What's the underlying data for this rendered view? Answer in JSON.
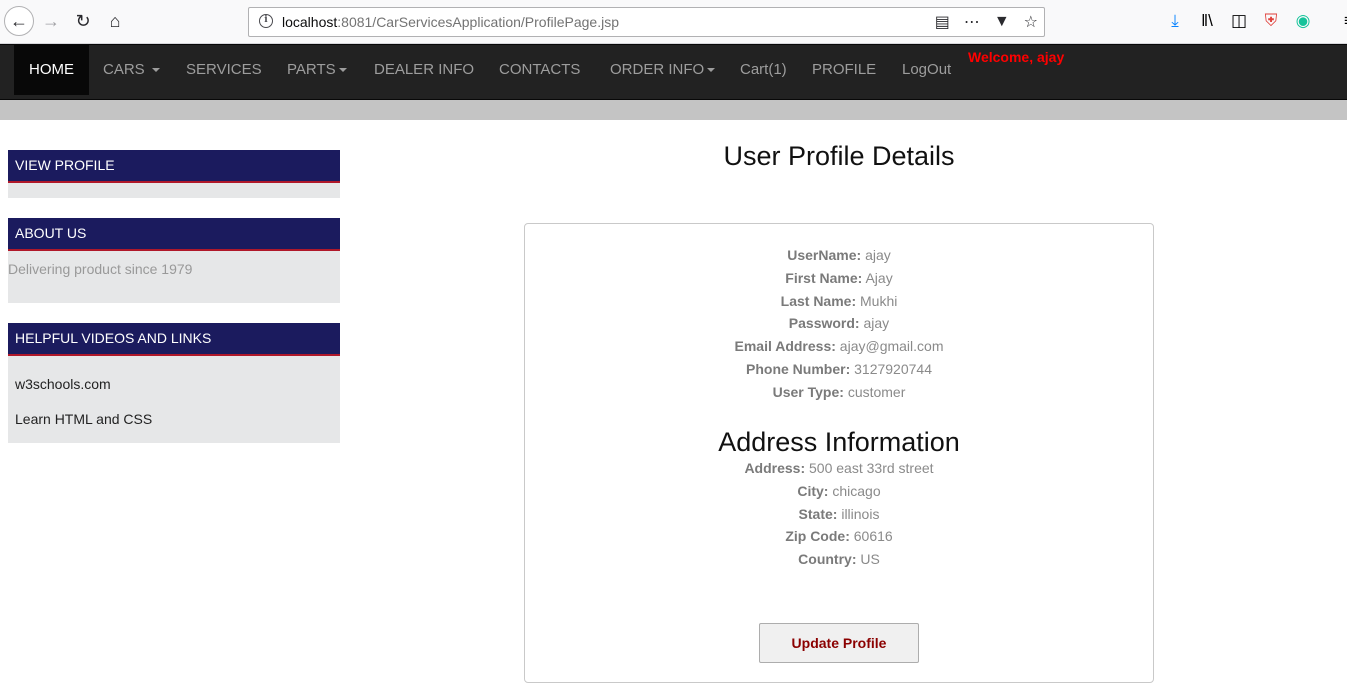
{
  "browser": {
    "url_host": "localhost",
    "url_rest": ":8081/CarServicesApplication/ProfilePage.jsp",
    "icons": [
      "back-icon",
      "forward-icon",
      "reload-icon",
      "home-icon",
      "info-icon",
      "reader-view-icon",
      "more-icon",
      "pocket-icon",
      "star-icon",
      "download-icon",
      "library-icon",
      "sidebar-icon",
      "shield-extension-icon",
      "grammarly-icon",
      "menu-icon"
    ]
  },
  "navbar": {
    "items": [
      {
        "label": "HOME"
      },
      {
        "label": "CARS"
      },
      {
        "label": "SERVICES"
      },
      {
        "label": "PARTS"
      },
      {
        "label": "DEALER INFO"
      },
      {
        "label": "CONTACTS"
      },
      {
        "label": "ORDER INFO"
      },
      {
        "label": "Cart(1)"
      },
      {
        "label": "PROFILE"
      },
      {
        "label": "LogOut"
      }
    ],
    "welcome": "Welcome, ajay"
  },
  "sidebar": {
    "view_profile": "VIEW PROFILE",
    "about_us": "ABOUT US",
    "about_text": "Delivering product since 1979",
    "helpful": "HELPFUL VIDEOS AND LINKS",
    "links": [
      "w3schools.com",
      "Learn HTML and CSS"
    ]
  },
  "main": {
    "title": "User Profile Details",
    "profile": [
      {
        "label": "UserName:",
        "value": "ajay"
      },
      {
        "label": "First Name:",
        "value": "Ajay"
      },
      {
        "label": "Last Name:",
        "value": "Mukhi"
      },
      {
        "label": "Password:",
        "value": "ajay"
      },
      {
        "label": "Email Address:",
        "value": "ajay@gmail.com"
      },
      {
        "label": "Phone Number:",
        "value": "3127920744"
      },
      {
        "label": "User Type:",
        "value": "customer"
      }
    ],
    "address_title": "Address Information",
    "address": [
      {
        "label": "Address:",
        "value": "500 east 33rd street"
      },
      {
        "label": "City:",
        "value": "chicago"
      },
      {
        "label": "State:",
        "value": "illinois"
      },
      {
        "label": "Zip Code:",
        "value": "60616"
      },
      {
        "label": "Country:",
        "value": "US"
      }
    ],
    "update_button": "Update Profile"
  },
  "colors": {
    "navbar_bg": "#222222",
    "panel_head_bg": "#1b1b5e",
    "panel_accent": "#b0182a",
    "welcome": "#ff0000",
    "button_text": "#8b0000"
  }
}
